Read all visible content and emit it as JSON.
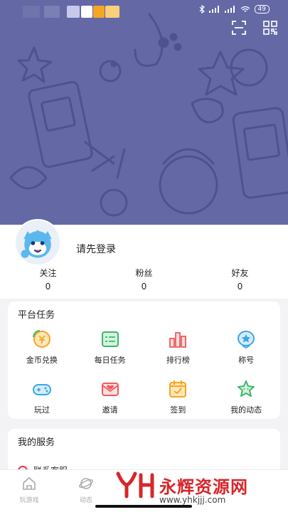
{
  "header": {
    "bg_color": "#6469a6",
    "status_battery": "49",
    "scan_icon": "scan-icon",
    "qr_icon": "qr-code-icon"
  },
  "profile": {
    "login_prompt": "请先登录",
    "stats": [
      {
        "label": "关注",
        "value": "0"
      },
      {
        "label": "粉丝",
        "value": "0"
      },
      {
        "label": "好友",
        "value": "0"
      }
    ]
  },
  "tasks": {
    "title": "平台任务",
    "items": [
      {
        "label": "金币兑换",
        "icon": "coin-exchange-icon",
        "color": "#f5a623"
      },
      {
        "label": "每日任务",
        "icon": "daily-task-icon",
        "color": "#3bb86a"
      },
      {
        "label": "排行榜",
        "icon": "ranking-icon",
        "color": "#ee5a5a"
      },
      {
        "label": "称号",
        "icon": "title-badge-icon",
        "color": "#3aa7e8"
      },
      {
        "label": "玩过",
        "icon": "gamepad-icon",
        "color": "#3aa7e8"
      },
      {
        "label": "邀请",
        "icon": "invite-envelope-icon",
        "color": "#ee5a5a"
      },
      {
        "label": "签到",
        "icon": "checkin-calendar-icon",
        "color": "#f5a623"
      },
      {
        "label": "我的动态",
        "icon": "star-bubble-icon",
        "color": "#3bb86a"
      }
    ]
  },
  "services": {
    "title": "我的服务",
    "first_item": "联系客服"
  },
  "tabbar": {
    "items": [
      {
        "label": "玩游戏",
        "icon": "home-icon"
      },
      {
        "label": "动态",
        "icon": "planet-icon"
      }
    ]
  },
  "watermark": {
    "text": "永辉资源网",
    "url": "www.yhkjjj.com"
  }
}
